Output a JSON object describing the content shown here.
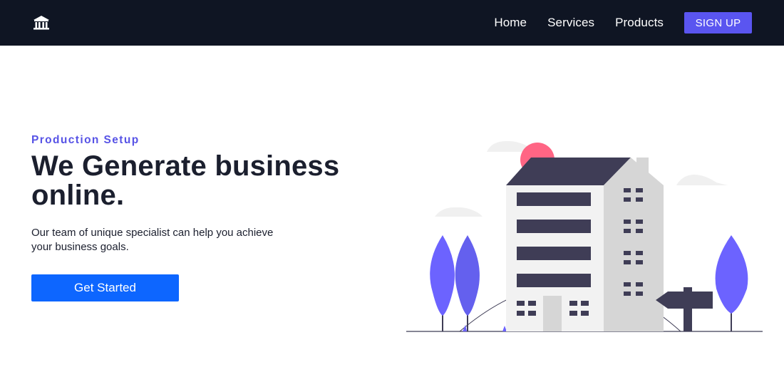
{
  "nav": {
    "logo_icon": "bank-icon",
    "links": [
      "Home",
      "Services",
      "Products"
    ],
    "signup_label": "SIGN UP"
  },
  "hero": {
    "eyebrow": "Production Setup",
    "headline_line1": "We Generate business",
    "headline_line2": "online.",
    "subtext_line1": "Our team of unique specialist can help you achieve",
    "subtext_line2": "your business goals.",
    "cta_label": "Get Started"
  },
  "illustration": {
    "icon": "office-building-illustration"
  },
  "colors": {
    "navbar_bg": "#0f1523",
    "accent": "#5a55f0",
    "cta": "#0d66ff",
    "headline": "#1b1f2e",
    "building_dark": "#3f3d56",
    "tree": "#6c63ff",
    "sun": "#ff6584"
  }
}
